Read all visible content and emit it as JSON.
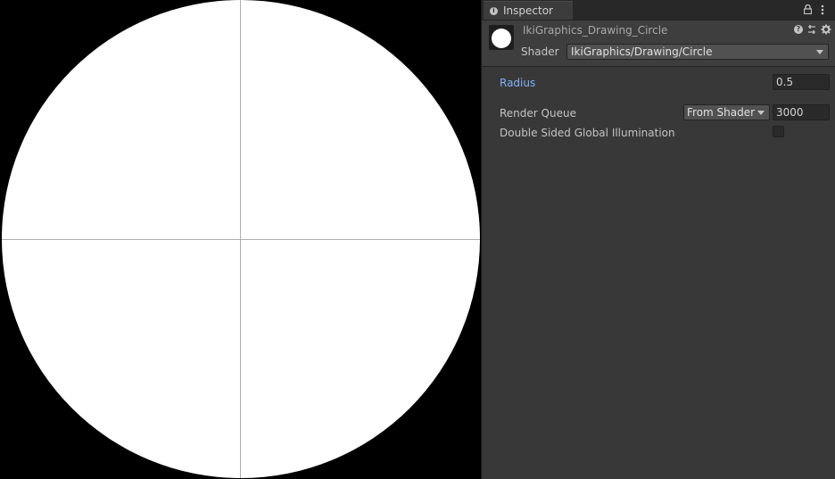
{
  "inspector": {
    "tab_label": "Inspector",
    "material_name": "IkiGraphics_Drawing_Circle",
    "shader_label": "Shader",
    "shader_value": "IkiGraphics/Drawing/Circle",
    "properties": {
      "radius_label": "Radius",
      "radius_value": "0.5",
      "render_queue_label": "Render Queue",
      "render_queue_mode": "From Shader",
      "render_queue_value": "3000",
      "dsgi_label": "Double Sided Global Illumination",
      "dsgi_checked": false
    }
  },
  "icons": {
    "tab": "info-icon",
    "tab_actions": [
      "lock-icon",
      "kebab-menu-icon"
    ],
    "header_actions": [
      "help-icon",
      "preset-icon",
      "gear-icon"
    ]
  },
  "colors": {
    "accent_label": "#7fb2f7",
    "panel_bg": "#383838",
    "scene_bg": "#000000",
    "circle": "#ffffff"
  }
}
